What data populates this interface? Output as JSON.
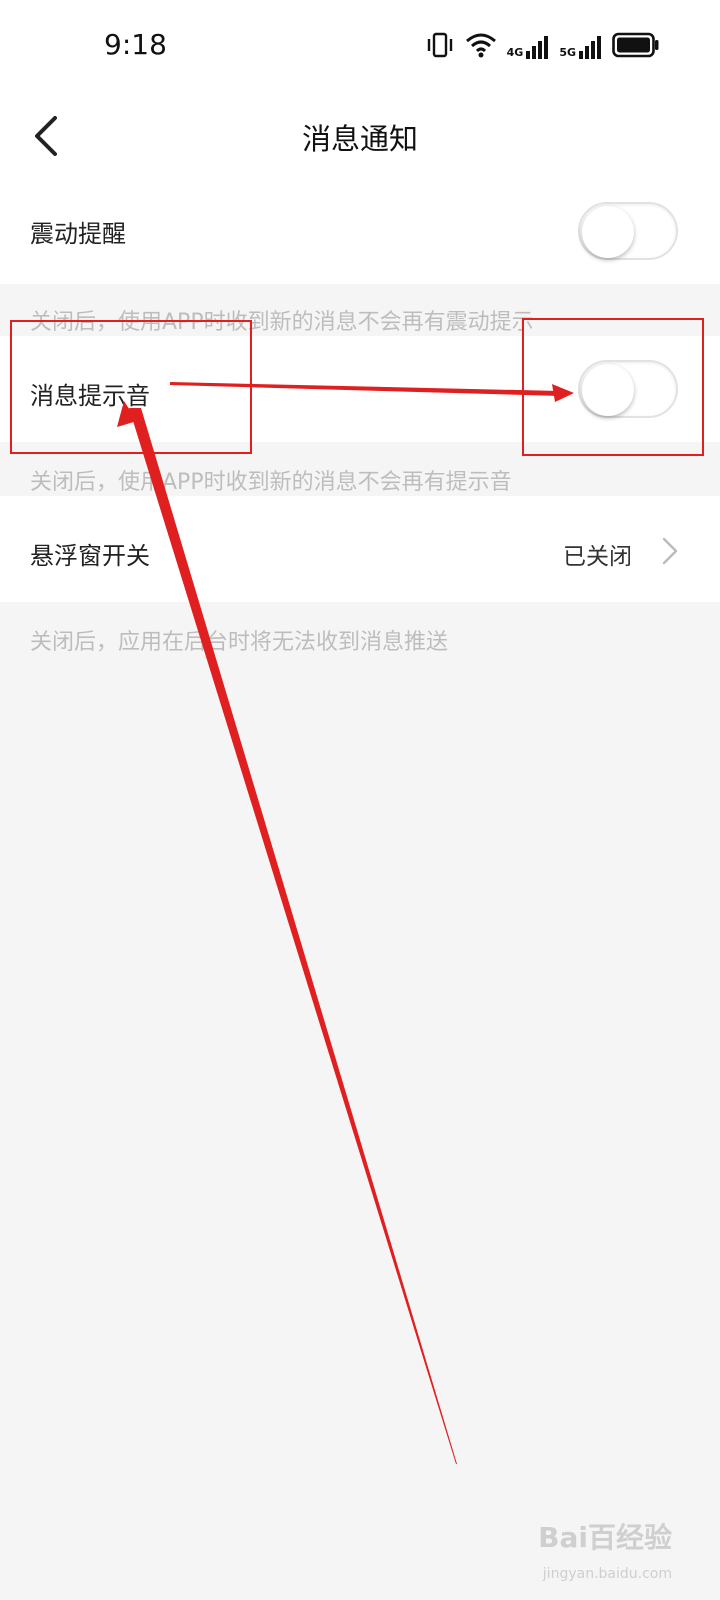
{
  "status_bar": {
    "time": "9:18",
    "net_4g": "4G",
    "net_5g": "5G",
    "icons": [
      "vibrate-icon",
      "wifi-icon",
      "signal-4g-icon",
      "signal-5g-icon",
      "battery-icon"
    ]
  },
  "nav": {
    "back_icon": "chevron-left-icon",
    "title": "消息通知"
  },
  "settings": {
    "vibration": {
      "label": "震动提醒",
      "enabled": false,
      "hint": "关闭后，使用APP时收到新的消息不会再有震动提示"
    },
    "sound": {
      "label": "消息提示音",
      "enabled": false,
      "hint": "关闭后，使用APP时收到新的消息不会再有提示音"
    },
    "floating_window": {
      "label": "悬浮窗开关",
      "value": "已关闭",
      "hint": "关闭后，应用在后台时将无法收到消息推送"
    }
  },
  "colors": {
    "annotation": "#e02020",
    "hint": "#bdbdbd",
    "background": "#f5f5f5"
  },
  "watermark": {
    "brand": "Bai百经验",
    "site": "jingyan.baidu.com"
  }
}
